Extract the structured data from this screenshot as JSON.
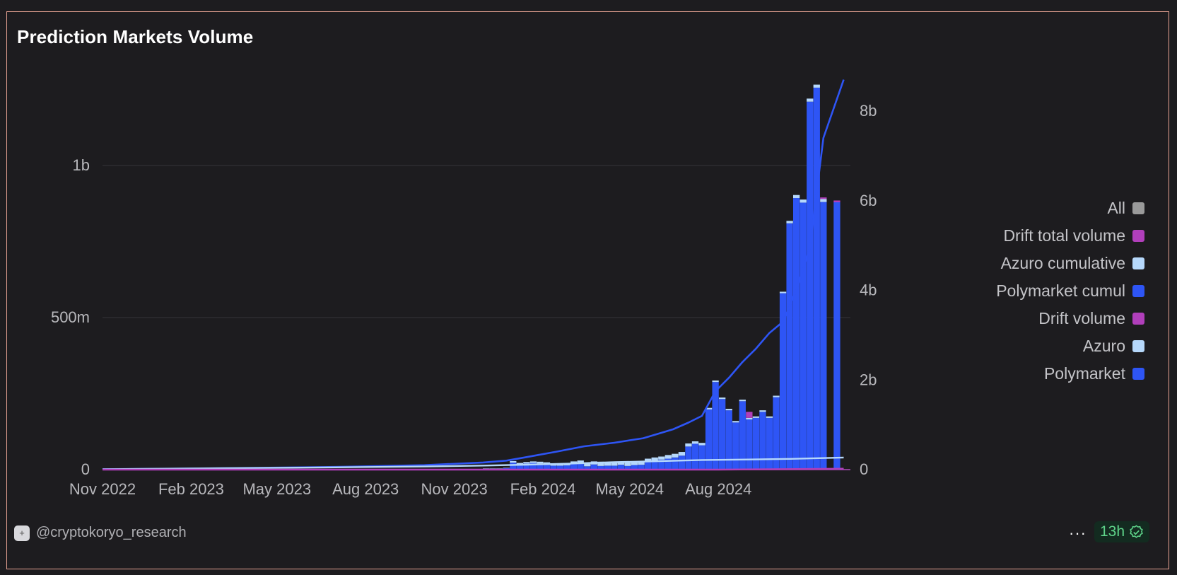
{
  "header": {
    "title": "Prediction Markets Volume"
  },
  "footer": {
    "author": "@cryptokoryo_research",
    "more_label": "···",
    "refresh_label": "13h"
  },
  "colors": {
    "polymarket": "#2e55f5",
    "azuro": "#b6d8fb",
    "drift": "#b13fbb",
    "all": "#9a9a9a",
    "grid": "#35353a",
    "background": "#1d1c1f"
  },
  "legend": [
    {
      "label": "All",
      "color": "#9a9a9a"
    },
    {
      "label": "Drift total volume",
      "color": "#b13fbb"
    },
    {
      "label": "Azuro cumulative",
      "color": "#b6d8fb"
    },
    {
      "label": "Polymarket cumul",
      "color": "#2e55f5"
    },
    {
      "label": "Drift volume",
      "color": "#b13fbb"
    },
    {
      "label": "Azuro",
      "color": "#b6d8fb"
    },
    {
      "label": "Polymarket",
      "color": "#2e55f5"
    }
  ],
  "chart_data": {
    "type": "bar",
    "title": "Prediction Markets Volume",
    "x_axis": {
      "tick_labels": [
        "Nov 2022",
        "Feb 2023",
        "May 2023",
        "Aug 2023",
        "Nov 2023",
        "Feb 2024",
        "May 2024",
        "Aug 2024"
      ],
      "range": [
        "2022-11-01",
        "2024-12-16"
      ]
    },
    "y_axis_left": {
      "range": [
        0,
        1300000000
      ],
      "ticks": [
        0,
        500000000,
        1000000000
      ],
      "tick_labels": [
        "0",
        "500m",
        "1b"
      ]
    },
    "y_axis_right": {
      "range": [
        0,
        8800000000
      ],
      "ticks": [
        0,
        2000000000,
        4000000000,
        6000000000,
        8000000000
      ],
      "tick_labels": [
        "0",
        "2b",
        "4b",
        "6b",
        "8b"
      ]
    },
    "grid": true,
    "legend_position": "right",
    "bar_series": [
      {
        "name": "Polymarket",
        "color": "#2e55f5",
        "axis": "left"
      },
      {
        "name": "Azuro",
        "color": "#b6d8fb",
        "axis": "left"
      },
      {
        "name": "Drift volume",
        "color": "#b13fbb",
        "axis": "left"
      }
    ],
    "weekly": {
      "x": [
        "2023-12-04",
        "2023-12-11",
        "2023-12-18",
        "2023-12-25",
        "2024-01-01",
        "2024-01-08",
        "2024-01-15",
        "2024-01-22",
        "2024-01-29",
        "2024-02-05",
        "2024-02-12",
        "2024-02-19",
        "2024-02-26",
        "2024-03-04",
        "2024-03-11",
        "2024-03-18",
        "2024-03-25",
        "2024-04-01",
        "2024-04-08",
        "2024-04-15",
        "2024-04-22",
        "2024-04-29",
        "2024-05-06",
        "2024-05-13",
        "2024-05-20",
        "2024-05-27",
        "2024-06-03",
        "2024-06-10",
        "2024-06-17",
        "2024-06-24",
        "2024-07-01",
        "2024-07-08",
        "2024-07-15",
        "2024-07-22",
        "2024-07-29",
        "2024-08-05",
        "2024-08-12",
        "2024-08-19",
        "2024-08-26",
        "2024-09-02",
        "2024-09-09",
        "2024-09-16",
        "2024-09-23",
        "2024-09-30",
        "2024-10-07",
        "2024-10-14",
        "2024-10-21",
        "2024-10-28",
        "2024-11-04",
        "2024-11-11",
        "2024-11-18",
        "2024-11-25"
      ],
      "Polymarket": [
        3000000,
        3000000,
        3000000,
        5000000,
        23000000,
        17000000,
        20000000,
        22000000,
        20000000,
        18000000,
        13000000,
        13000000,
        14000000,
        19000000,
        22000000,
        11000000,
        17000000,
        12000000,
        13000000,
        13000000,
        16000000,
        12000000,
        15000000,
        16000000,
        26000000,
        30000000,
        33000000,
        36000000,
        40000000,
        46000000,
        76000000,
        85000000,
        80000000,
        198000000,
        288000000,
        232000000,
        195000000,
        155000000,
        225000000,
        165000000,
        170000000,
        190000000,
        170000000,
        238000000,
        580000000,
        810000000,
        893000000,
        878000000,
        1210000000,
        1256000000,
        880000000,
        0
      ],
      "Azuro": [
        1000000,
        1000000,
        1000000,
        1000000,
        5000000,
        5000000,
        5000000,
        5000000,
        6000000,
        6000000,
        7000000,
        7000000,
        8000000,
        8000000,
        8000000,
        10000000,
        10000000,
        14000000,
        12000000,
        10000000,
        8000000,
        12000000,
        12000000,
        10000000,
        10000000,
        10000000,
        10000000,
        12000000,
        12000000,
        12000000,
        10000000,
        8000000,
        8000000,
        5000000,
        5000000,
        5000000,
        5000000,
        5000000,
        5000000,
        5000000,
        5000000,
        5000000,
        5000000,
        5000000,
        5000000,
        8000000,
        10000000,
        10000000,
        10000000,
        10000000,
        10000000,
        0
      ],
      "Drift volume": [
        0,
        0,
        0,
        0,
        0,
        0,
        0,
        0,
        0,
        0,
        0,
        0,
        0,
        0,
        0,
        0,
        0,
        0,
        0,
        0,
        0,
        0,
        0,
        0,
        0,
        0,
        0,
        0,
        0,
        0,
        0,
        0,
        0,
        0,
        0,
        0,
        0,
        0,
        0,
        20000000,
        0,
        0,
        0,
        0,
        0,
        0,
        0,
        0,
        0,
        0,
        5000000,
        0
      ]
    },
    "line_series": [
      {
        "name": "Polymarket cumul",
        "color": "#2e55f5",
        "axis": "right",
        "x": [
          "2022-11-01",
          "2023-03-01",
          "2023-07-01",
          "2023-10-01",
          "2023-12-01",
          "2023-12-25",
          "2024-01-15",
          "2024-02-15",
          "2024-03-15",
          "2024-04-15",
          "2024-05-15",
          "2024-06-15",
          "2024-07-01",
          "2024-07-15",
          "2024-07-29",
          "2024-08-12",
          "2024-08-26",
          "2024-09-09",
          "2024-09-23",
          "2024-10-07",
          "2024-10-21",
          "2024-11-04",
          "2024-11-11",
          "2024-11-18",
          "2024-12-09"
        ],
        "values": [
          10000000,
          30000000,
          60000000,
          100000000,
          160000000,
          200000000,
          280000000,
          400000000,
          520000000,
          600000000,
          700000000,
          900000000,
          1050000000,
          1200000000,
          1750000000,
          2050000000,
          2400000000,
          2700000000,
          3050000000,
          3300000000,
          4000000000,
          4950000000,
          6200000000,
          7400000000,
          8700000000
        ]
      },
      {
        "name": "Azuro cumulative",
        "color": "#b6d8fb",
        "axis": "right",
        "x": [
          "2022-11-01",
          "2023-03-01",
          "2023-07-01",
          "2023-10-01",
          "2023-12-01",
          "2024-01-15",
          "2024-03-01",
          "2024-04-15",
          "2024-06-01",
          "2024-07-15",
          "2024-09-01",
          "2024-10-15",
          "2024-12-09"
        ],
        "values": [
          10000000,
          30000000,
          50000000,
          70000000,
          90000000,
          110000000,
          135000000,
          165000000,
          190000000,
          215000000,
          225000000,
          240000000,
          270000000
        ]
      },
      {
        "name": "Drift total volume",
        "color": "#b13fbb",
        "axis": "right",
        "x": [
          "2022-11-01",
          "2024-08-01",
          "2024-12-09"
        ],
        "values": [
          0,
          0,
          20000000
        ]
      },
      {
        "name": "All",
        "color": "#9a9a9a",
        "axis": "right",
        "x": [],
        "values": []
      }
    ]
  }
}
